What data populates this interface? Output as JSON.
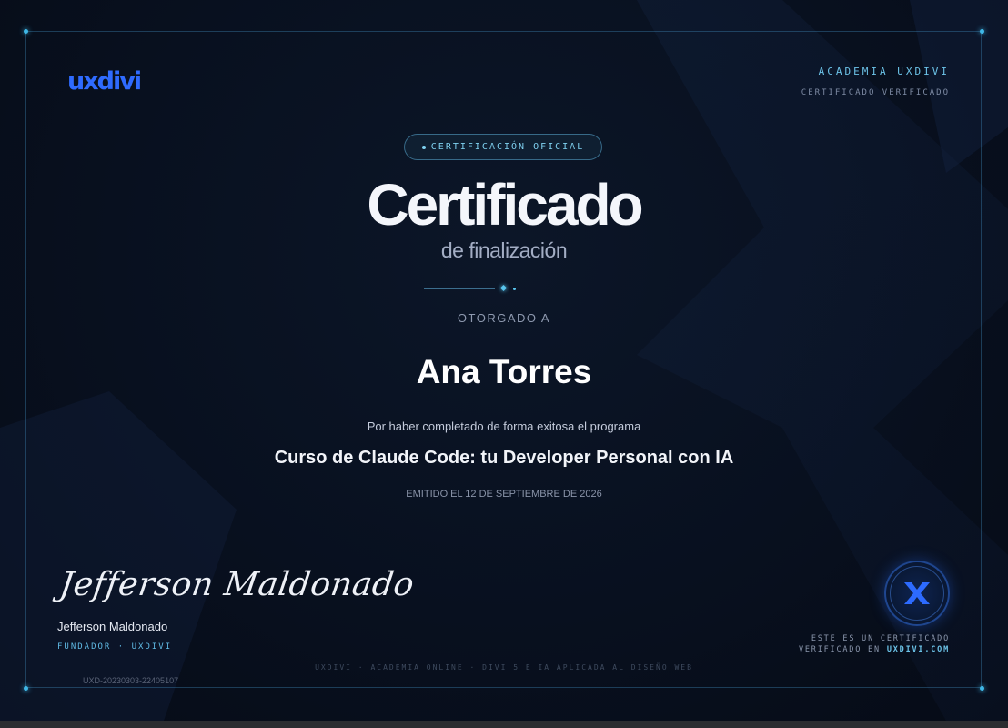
{
  "header": {
    "logo_text": "uxdivi",
    "academy": "ACADEMIA UXDIVI",
    "verified": "CERTIFICADO VERIFICADO"
  },
  "badge": "CERTIFICACIÓN OFICIAL",
  "title": "Certificado",
  "subtitle": "de finalización",
  "awarded_label": "OTORGADO A",
  "recipient": "Ana Torres",
  "description": "Por haber completado de forma exitosa el programa",
  "course": "Curso de Claude Code: tu Developer Personal con IA",
  "issued": "EMITIDO EL 12 DE SEPTIEMBRE DE 2026",
  "signature": {
    "name": "Jefferson Maldonado",
    "role": "FUNDADOR · UXDIVI"
  },
  "certificate_id": "UXD-20230303-22405107",
  "footer": "UXDIVI · ACADEMIA ONLINE · DIVI 5 E IA APLICADA AL DISEÑO WEB",
  "verification": {
    "line1": "ESTE ES UN CERTIFICADO",
    "line2_prefix": "VERIFICADO EN ",
    "line2_link": "UXDIVI.COM"
  },
  "colors": {
    "accent": "#3fb7e6",
    "brand_blue": "#2f6bff",
    "background": "#08101f"
  },
  "icons": {
    "seal": "x-seal-icon"
  }
}
